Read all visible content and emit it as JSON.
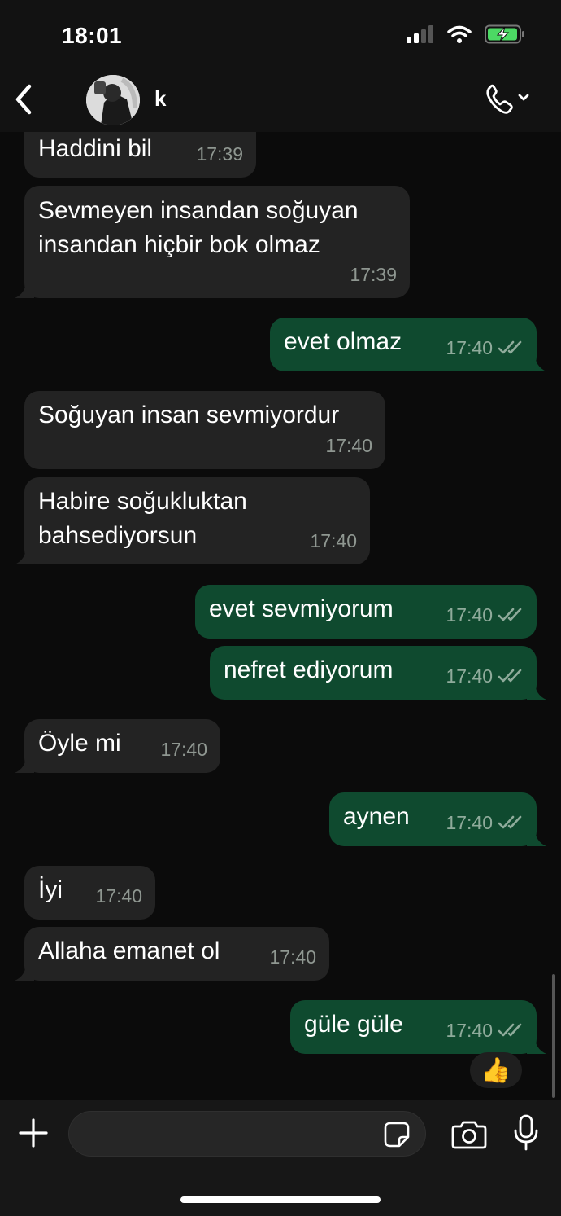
{
  "status_bar": {
    "time": "18:01"
  },
  "header": {
    "contact_name": "k"
  },
  "messages": [
    {
      "dir": "in",
      "text": "Haddini bil",
      "time": "17:39"
    },
    {
      "dir": "in",
      "text": "Sevmeyen insandan soğuyan",
      "text2": "insandan hiçbir bok olmaz",
      "time": "17:39"
    },
    {
      "dir": "out",
      "text": "evet olmaz",
      "time": "17:40"
    },
    {
      "dir": "in",
      "text": "Soğuyan insan sevmiyordur",
      "time": "17:40"
    },
    {
      "dir": "in",
      "text": "Habire soğukluktan",
      "text2": "bahsediyorsun",
      "time": "17:40"
    },
    {
      "dir": "out",
      "text": "evet sevmiyorum",
      "time": "17:40"
    },
    {
      "dir": "out",
      "text": "nefret ediyorum",
      "time": "17:40"
    },
    {
      "dir": "in",
      "text": "Öyle mi",
      "time": "17:40"
    },
    {
      "dir": "out",
      "text": "aynen",
      "time": "17:40"
    },
    {
      "dir": "in",
      "text": "İyi",
      "time": "17:40"
    },
    {
      "dir": "in",
      "text": "Allaha emanet ol",
      "time": "17:40"
    },
    {
      "dir": "out",
      "text": "güle güle",
      "time": "17:40"
    }
  ],
  "reaction": {
    "emoji": "👍"
  },
  "composer": {
    "placeholder": ""
  },
  "colors": {
    "incoming_bubble": "#232323",
    "outgoing_bubble": "#0f4a2f",
    "background": "#0b0b0b"
  }
}
